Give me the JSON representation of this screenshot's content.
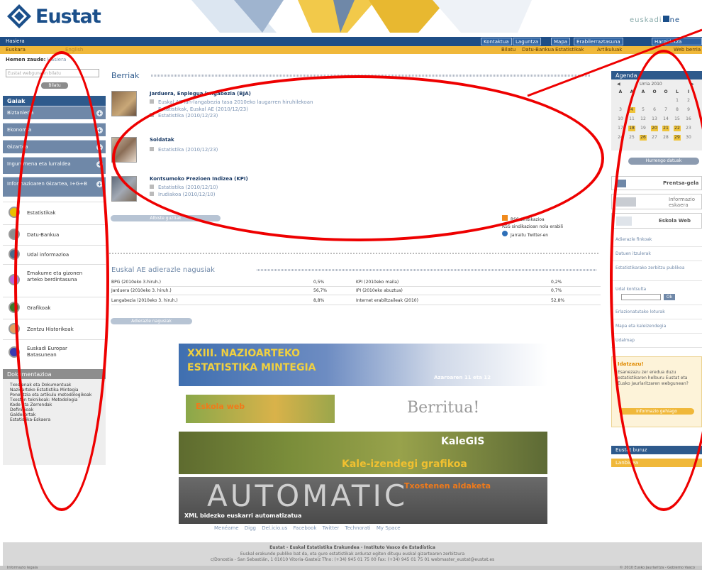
{
  "header": {
    "logo_text": "Eustat",
    "euskadi_text": "euskadi",
    "euskadi_suffix": "ne"
  },
  "nav": {
    "home": "Hasiera",
    "buttons": [
      "Kontaktua",
      "Laguntza",
      "Mapa",
      "Erabilerraztasuna",
      "Harpidetza"
    ]
  },
  "subnav": {
    "lang": [
      "Euskara",
      "English"
    ],
    "links": [
      "Bilatu",
      "Datu-Bankua",
      "Estatistikak",
      "Artikuluak",
      "Web berria"
    ]
  },
  "breadcrumb": {
    "label": "Hemen zaude:",
    "current": "Hasiera"
  },
  "search": {
    "placeholder": "Eustat webgunean bilatu",
    "button": "Bilatu"
  },
  "leftnav": {
    "title": "Gaiak",
    "items": [
      "Biztanleria",
      "Ekonomia",
      "Gizartea",
      "Ingurumena eta lurraldea",
      "Informazioaren Gizartea, I+G+B"
    ],
    "circles": [
      {
        "label": "Estatistikak"
      },
      {
        "label": "Datu-Bankua"
      },
      {
        "label": "Udal informazioa"
      },
      {
        "label": "Emakume eta gizonen arteko berdintasuna"
      },
      {
        "label": "Grafikoak"
      },
      {
        "label": "Zentzu Historikoak"
      },
      {
        "label": "Euskadi Europar Batasunean"
      }
    ],
    "circle_colors": [
      "#e8c000",
      "#8c8c8c",
      "#4a6a8a",
      "#b86ad8",
      "#3c7a2a",
      "#e0a060",
      "#3a3ab0"
    ],
    "dok_title": "Dokumentazioa",
    "dok_items": [
      "Txostenak eta Dokumentuak",
      "Nazioarteko Estatistika Mintegia",
      "Ponentzia eta artikulu metodologikoak",
      "Txosten teknikoak: Metodologia",
      "Kode eta Zerrendak",
      "Definizioak",
      "Galdesortak",
      "Estatistika-Eskaera"
    ]
  },
  "berriak": {
    "title": "Berriak",
    "items": [
      {
        "title": "Jarduera, Enplegua langabezia (BJA)",
        "lines": [
          "Euskal AE lan-langabezia tasa 2010eko laugarren hiruhilekoan",
          "Estatistikak, Euskal AE (2010/12/23)",
          "Estatistika (2010/12/23)"
        ]
      },
      {
        "title": "Soldatak",
        "lines": [
          "Estatistika (2010/12/23)"
        ]
      },
      {
        "title": "Kontsumoko Prezioen Indizea (KPI)",
        "lines": [
          "Estatistika (2010/12/10)",
          "Irudiakoa (2010/12/10)"
        ]
      }
    ],
    "all_button": "Albiste guztiak",
    "rss": [
      "RSS Sindikazioa",
      "RSS sindikazioan nola erabili",
      "Jarraitu Twitter-en"
    ]
  },
  "indicators": {
    "title": "Euskal AE adierazle nagusiak",
    "rows": [
      {
        "left": "BPG (2010eko 3.hiruh.)",
        "lval": "0,5%",
        "right": "KPI (2010eko maila)",
        "rval": "0,2%"
      },
      {
        "left": "Jarduera (2010eko 3. hiruh.)",
        "lval": "56,7%",
        "right": "IPI (2010eko abuztua)",
        "rval": "0,7%"
      },
      {
        "left": "Langabezia (2010eko 3. hiruh.)",
        "lval": "8,8%",
        "right": "Internet erabiltzaileak (2010)",
        "rval": "52,8%"
      }
    ],
    "button": "Adierazle nagusiak"
  },
  "banners": {
    "b1": [
      "XXIII. NAZIOARTEKO",
      "ESTATISTIKA MINTEGIA",
      "Azaroaren 11 eta 12"
    ],
    "b2": [
      "Eskola web",
      "Berritua!"
    ],
    "b3": [
      "KaleGIS",
      "Kale-izendegi grafikoa"
    ],
    "b4": [
      "AUTOMATIC",
      "Txostenen aldaketa",
      "XML bidezko euskarri automatizatua"
    ]
  },
  "share": [
    "Menéame",
    "Digg",
    "Del.icio.us",
    "Facebook",
    "Twitter",
    "Technorati",
    "My Space"
  ],
  "agenda": {
    "title": "Agenda",
    "month": "Urria 2010",
    "weekdays": [
      "A",
      "A",
      "A",
      "O",
      "O",
      "L",
      "I"
    ],
    "weeks": [
      [
        "",
        "",
        "",
        "",
        "",
        "1",
        "2"
      ],
      [
        "3",
        "4",
        "5",
        "6",
        "7",
        "8",
        "9"
      ],
      [
        "10",
        "11",
        "12",
        "13",
        "14",
        "15",
        "16"
      ],
      [
        "17",
        "18",
        "19",
        "20",
        "21",
        "22",
        "23"
      ],
      [
        "24",
        "25",
        "26",
        "27",
        "28",
        "29",
        "30"
      ]
    ],
    "highlights": [
      "4",
      "18",
      "20",
      "21",
      "22",
      "26",
      "29"
    ],
    "button": "Hurrengo datuak"
  },
  "right": {
    "prentsa": "Prentsa-gela",
    "informazioa": "Informazio eskaera",
    "eskola": "Eskola Web",
    "links": [
      "Adierazle finkoak",
      "Datuen itzulerak",
      "Estatistikarako zerbitzu publikoa",
      "Udal kontsulta",
      "Erlazionatutako loturak",
      "Mapa eta kaleizendegia",
      "Udalmap"
    ],
    "idatz_title": "Idatzazu!",
    "idatz_text": "Esanezazu zer eredua duzu estatistikaren helburu Eustat eta Eusko Jaurlaritzaren webgunean?",
    "idatz_button": "Informazio gehiago",
    "eustat_box": "Eustat buruz",
    "ardatz_box": "Lanbidea"
  },
  "footer": {
    "line1": "Eustat - Euskal Estatistika Erakundea - Instituto Vasco de Estadística",
    "line2": "Euskal erakunde publiko bat da, eta gure estatistikak arduraz egiten ditugu euskal gizartearen zerbitzura",
    "line3": "c/Donostia - San Sebastián, 1 01010 Vitoria-Gasteiz Tfno: (+34) 945 01 75 00 Fax: (+34) 945 01 75 01 webmaster_eustat@eustat.es",
    "bar_left": "Informazio legala",
    "bar_right": "© 2010 Eusko Jaurlaritza - Gobierno Vasco"
  }
}
